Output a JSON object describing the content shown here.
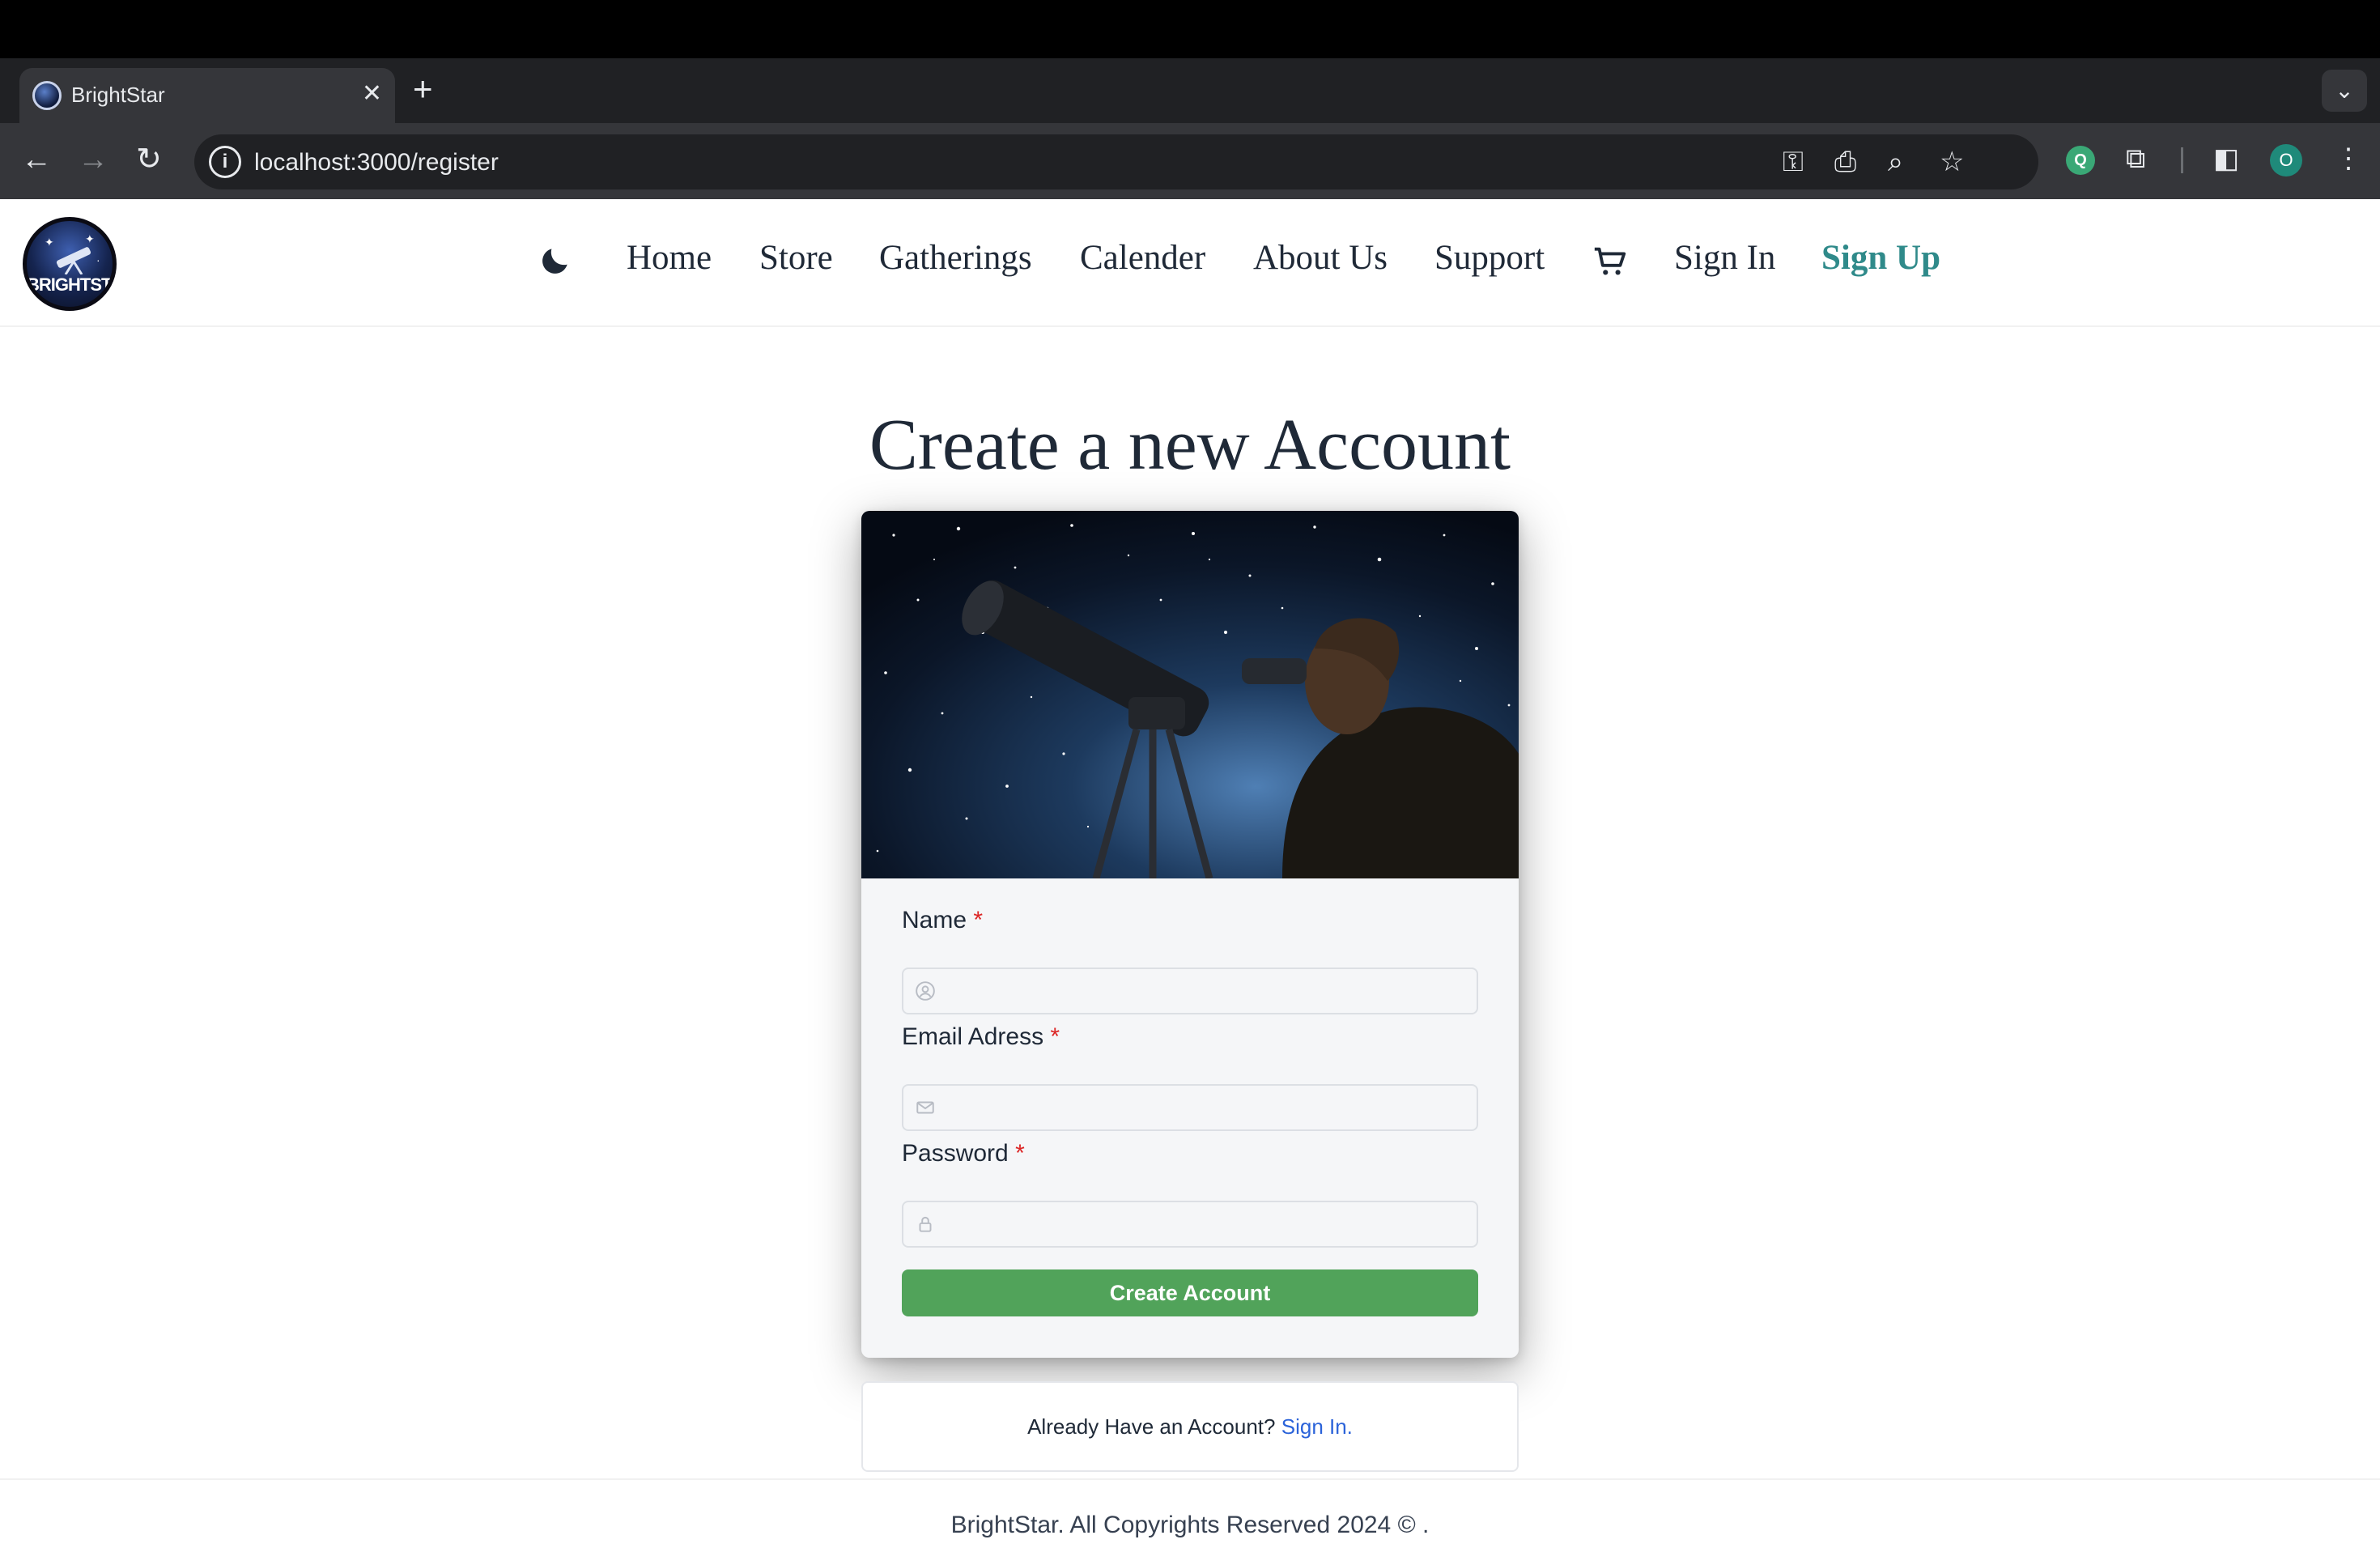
{
  "browser": {
    "tab_title": "BrightStar",
    "tab_close": "✕",
    "new_tab": "+",
    "tab_list": "⌄",
    "url": "localhost:3000/register",
    "profile_initial": "O",
    "ext_letter": "Q"
  },
  "site": {
    "logo_text": "BRIGHTSTAR",
    "nav": {
      "home": "Home",
      "store": "Store",
      "gatherings": "Gatherings",
      "calender": "Calender",
      "about": "About Us",
      "support": "Support",
      "sign_in": "Sign In",
      "sign_up": "Sign Up"
    },
    "accent_color": "#2f8a8a"
  },
  "register": {
    "title": "Create a new Account",
    "fields": {
      "name_label": "Name",
      "email_label": "Email Adress",
      "password_label": "Password",
      "required_mark": "*",
      "name_value": "",
      "email_value": "",
      "password_value": ""
    },
    "submit_label": "Create Account",
    "submit_color": "#51a35a"
  },
  "signin_prompt": {
    "text": "Already Have an Account?",
    "link": "Sign In."
  },
  "footer": {
    "text": "BrightStar. All Copyrights Reserved 2024 © ."
  }
}
